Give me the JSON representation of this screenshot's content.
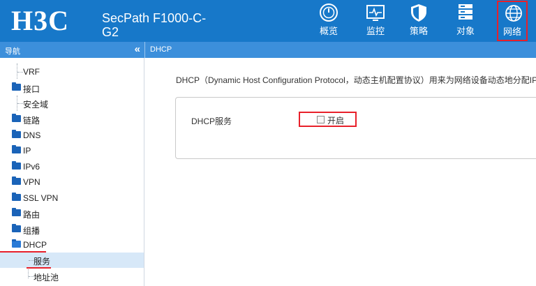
{
  "header": {
    "logo_text": "H3C",
    "model_line1": "SecPath F1000-C-",
    "model_line2": "G2",
    "background_color": "#1778c9",
    "nav": [
      {
        "label": "概览",
        "icon": "gauge-icon"
      },
      {
        "label": "监控",
        "icon": "monitor-icon"
      },
      {
        "label": "策略",
        "icon": "shield-icon"
      },
      {
        "label": "对象",
        "icon": "server-icon"
      },
      {
        "label": "网络",
        "icon": "globe-icon",
        "active": true
      }
    ]
  },
  "sidebar": {
    "title": "导航",
    "collapse_symbol": "«",
    "items": [
      {
        "label": "VRF",
        "type": "leaf"
      },
      {
        "label": "接口",
        "type": "folder"
      },
      {
        "label": "安全域",
        "type": "leaf"
      },
      {
        "label": "链路",
        "type": "folder"
      },
      {
        "label": "DNS",
        "type": "folder"
      },
      {
        "label": "IP",
        "type": "folder"
      },
      {
        "label": "IPv6",
        "type": "folder"
      },
      {
        "label": "VPN",
        "type": "folder"
      },
      {
        "label": "SSL VPN",
        "type": "folder"
      },
      {
        "label": "路由",
        "type": "folder"
      },
      {
        "label": "组播",
        "type": "folder"
      },
      {
        "label": "DHCP",
        "type": "folder-open"
      },
      {
        "label": "服务",
        "type": "child",
        "selected": true
      },
      {
        "label": "地址池",
        "type": "child"
      }
    ]
  },
  "main": {
    "breadcrumb": "DHCP",
    "description": "DHCP（Dynamic Host Configuration Protocol，动态主机配置协议）用来为网络设备动态地分配IP地址等网络配置参数。",
    "service_label": "DHCP服务",
    "enable_label": "开启",
    "enable_checked": false
  },
  "colors": {
    "accent_red": "#e8202a",
    "bar_blue": "#3c8fdb"
  }
}
